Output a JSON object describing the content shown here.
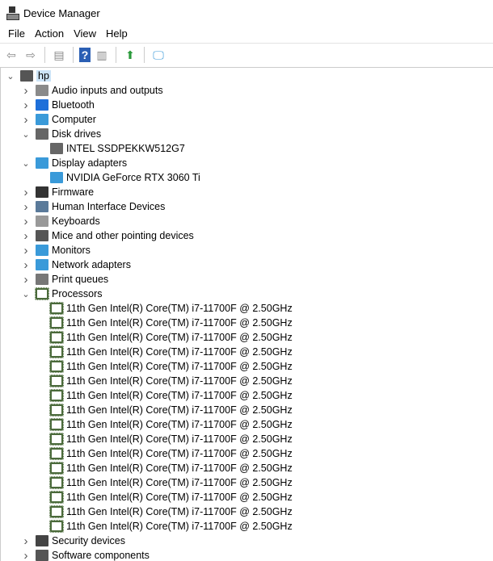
{
  "title": "Device Manager",
  "menu": [
    "File",
    "Action",
    "View",
    "Help"
  ],
  "toolbar": [
    "back-icon",
    "forward-icon",
    "show-hide-console-tree-icon",
    "help-icon",
    "properties-icon",
    "update-driver-icon",
    "scan-hardware-icon"
  ],
  "tree": {
    "root": "hp",
    "categories": [
      {
        "label": "Audio inputs and outputs",
        "expanded": false,
        "icon": "speaker-icon",
        "color": "#8a8a8a"
      },
      {
        "label": "Bluetooth",
        "expanded": false,
        "icon": "bluetooth-icon",
        "color": "#1e6fd9"
      },
      {
        "label": "Computer",
        "expanded": false,
        "icon": "computer-icon",
        "color": "#3a9ad9"
      },
      {
        "label": "Disk drives",
        "expanded": true,
        "icon": "disk-drive-icon",
        "color": "#666666",
        "children": [
          "INTEL SSDPEKKW512G7"
        ]
      },
      {
        "label": "Display adapters",
        "expanded": true,
        "icon": "display-adapter-icon",
        "color": "#3a9ad9",
        "children": [
          "NVIDIA GeForce RTX 3060 Ti"
        ]
      },
      {
        "label": "Firmware",
        "expanded": false,
        "icon": "firmware-icon",
        "color": "#333333"
      },
      {
        "label": "Human Interface Devices",
        "expanded": false,
        "icon": "hid-icon",
        "color": "#5a7a9a"
      },
      {
        "label": "Keyboards",
        "expanded": false,
        "icon": "keyboard-icon",
        "color": "#999999"
      },
      {
        "label": "Mice and other pointing devices",
        "expanded": false,
        "icon": "mouse-icon",
        "color": "#555555"
      },
      {
        "label": "Monitors",
        "expanded": false,
        "icon": "monitor-icon",
        "color": "#3a9ad9"
      },
      {
        "label": "Network adapters",
        "expanded": false,
        "icon": "network-icon",
        "color": "#3a9ad9"
      },
      {
        "label": "Print queues",
        "expanded": false,
        "icon": "printer-icon",
        "color": "#777777"
      },
      {
        "label": "Processors",
        "expanded": true,
        "icon": "processor-icon",
        "color": "#4a6a3a",
        "children": [
          "11th Gen Intel(R) Core(TM) i7-11700F @ 2.50GHz",
          "11th Gen Intel(R) Core(TM) i7-11700F @ 2.50GHz",
          "11th Gen Intel(R) Core(TM) i7-11700F @ 2.50GHz",
          "11th Gen Intel(R) Core(TM) i7-11700F @ 2.50GHz",
          "11th Gen Intel(R) Core(TM) i7-11700F @ 2.50GHz",
          "11th Gen Intel(R) Core(TM) i7-11700F @ 2.50GHz",
          "11th Gen Intel(R) Core(TM) i7-11700F @ 2.50GHz",
          "11th Gen Intel(R) Core(TM) i7-11700F @ 2.50GHz",
          "11th Gen Intel(R) Core(TM) i7-11700F @ 2.50GHz",
          "11th Gen Intel(R) Core(TM) i7-11700F @ 2.50GHz",
          "11th Gen Intel(R) Core(TM) i7-11700F @ 2.50GHz",
          "11th Gen Intel(R) Core(TM) i7-11700F @ 2.50GHz",
          "11th Gen Intel(R) Core(TM) i7-11700F @ 2.50GHz",
          "11th Gen Intel(R) Core(TM) i7-11700F @ 2.50GHz",
          "11th Gen Intel(R) Core(TM) i7-11700F @ 2.50GHz",
          "11th Gen Intel(R) Core(TM) i7-11700F @ 2.50GHz"
        ]
      },
      {
        "label": "Security devices",
        "expanded": false,
        "icon": "security-device-icon",
        "color": "#444444"
      },
      {
        "label": "Software components",
        "expanded": false,
        "icon": "software-component-icon",
        "color": "#555555"
      }
    ]
  }
}
